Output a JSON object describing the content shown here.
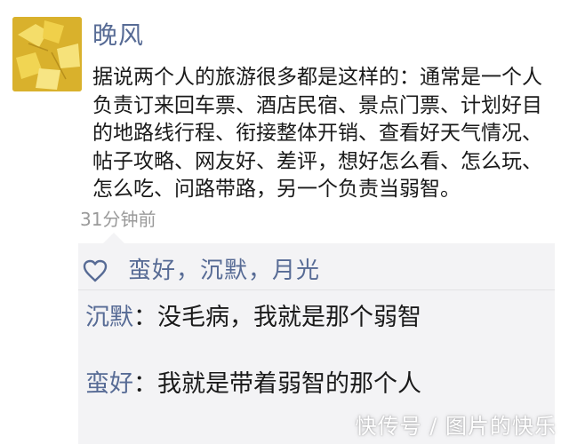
{
  "post": {
    "username": "晚风",
    "text": "据说两个人的旅游很多都是这样的：通常是一个人\n负责订来回车票、酒店民宿、景点门票、计划好目\n的地路线行程、衔接整体开销、查看好天气情况、\n帖子攻略、网友好、差评，想好怎么看、怎么玩、\n怎么吃、问路带路，另一个负责当弱智。",
    "timestamp": "31分钟前"
  },
  "likes": {
    "names": "蛮好，沉默，月光",
    "icon": "heart-icon"
  },
  "comments": [
    {
      "author": "沉默",
      "separator": "：",
      "text": "没毛病，我就是那个弱智"
    },
    {
      "author": "蛮好",
      "separator": "：",
      "text": "我就是带着弱智的那个人"
    }
  ],
  "watermark": "快传号 / 图片的快乐",
  "colors": {
    "link_blue": "#576b95",
    "comment_bg": "#f3f3f5",
    "timestamp_gray": "#9a9a9a"
  }
}
